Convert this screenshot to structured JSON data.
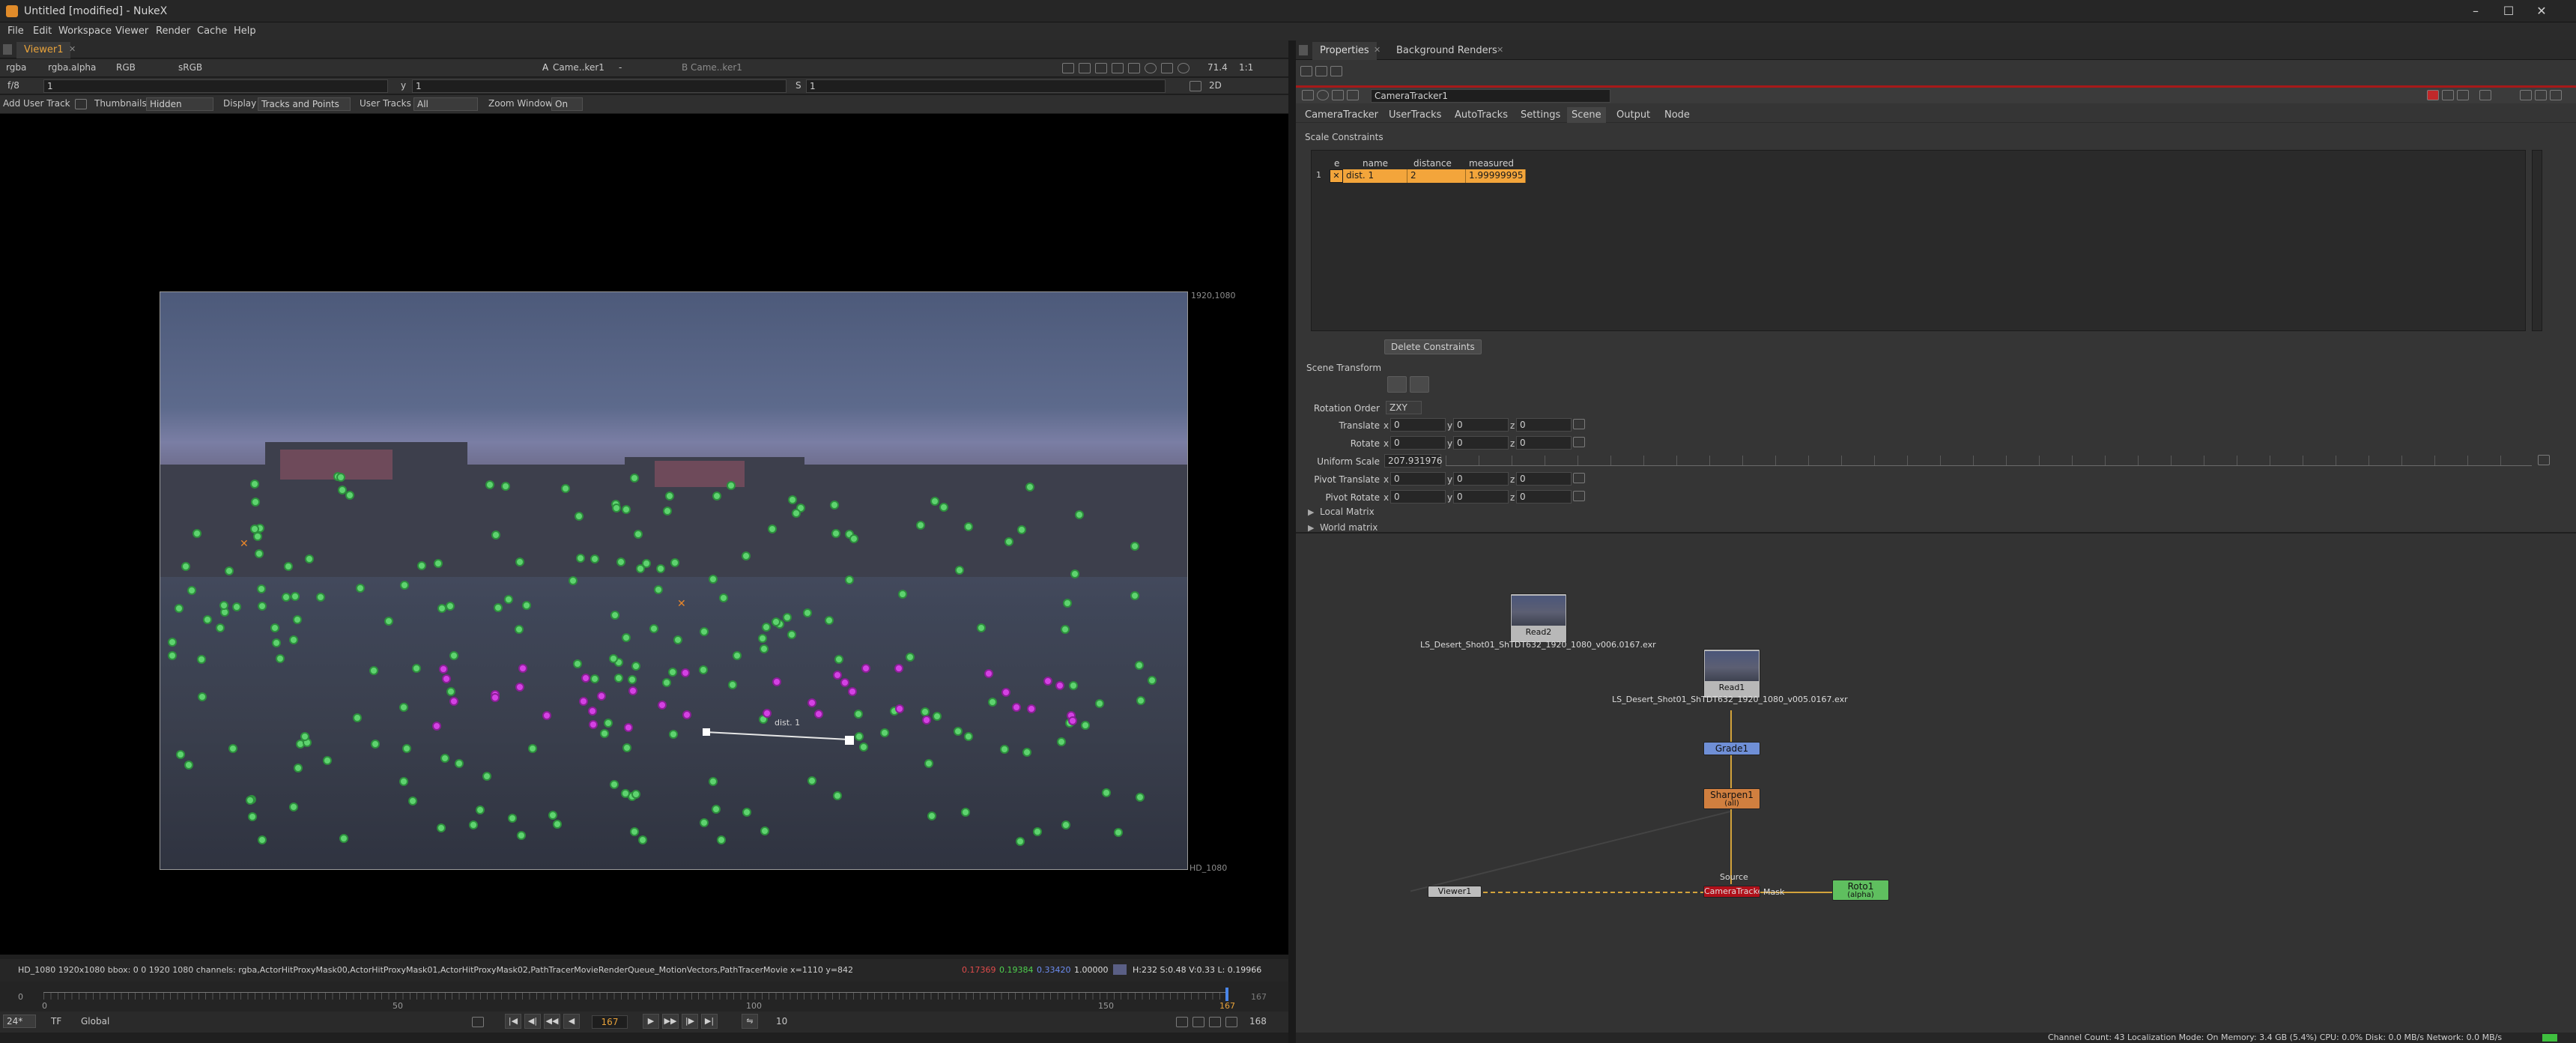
{
  "window": {
    "title": "Untitled [modified] - NukeX",
    "min_glyph": "–",
    "max_glyph": "☐",
    "close_glyph": "✕"
  },
  "menu": [
    "File",
    "Edit",
    "Workspace",
    "Viewer",
    "Render",
    "Cache",
    "Help"
  ],
  "viewer": {
    "tab_label": "Viewer1",
    "tab_close": "✕",
    "toolbar1": {
      "channels": "rgba",
      "alpha": "rgba.alpha",
      "colorspace": "RGB",
      "lut": "sRGB",
      "input_a_label": "A",
      "input_a": "Came..ker1",
      "input_a_op": "-",
      "input_b_label": "B",
      "input_b": "Came..ker1",
      "zoom": "71.4",
      "ratio": "1:1",
      "mode_2d": "2D"
    },
    "toolbar2": {
      "fstop_label": "f/8",
      "frame_val": "1",
      "gain_label": "y",
      "gamma_val": "1",
      "s_label": "S",
      "s_val": "1"
    },
    "toolbar3": {
      "add_user_track": "Add User Track",
      "thumbnails_label": "Thumbnails",
      "thumbnails_value": "Hidden",
      "display_label": "Display",
      "display_value": "Tracks and Points",
      "user_tracks_label": "User Tracks",
      "user_tracks_value": "All",
      "zoom_window_label": "Zoom Window",
      "zoom_window_value": "On"
    },
    "format_top_right": "1920,1080",
    "format_bottom_right": "HD_1080",
    "distance_label": "dist. 1",
    "status_text": "HD_1080 1920x1080  bbox: 0 0 1920 1080 channels: rgba,ActorHitProxyMask00,ActorHitProxyMask01,ActorHitProxyMask02,PathTracerMovieRenderQueue_MotionVectors,PathTracerMovie  x=1110 y=842",
    "pixel_r": "0.17369",
    "pixel_g": "0.19384",
    "pixel_b": "0.33420",
    "pixel_a": "1.00000",
    "pixel_hsv": "H:232 S:0.48 V:0.33  L: 0.19966",
    "timeline": {
      "start": "0",
      "ticks": [
        "0",
        "50",
        "100",
        "150"
      ],
      "end_label": "167",
      "end_right": "167"
    },
    "playbar": {
      "fps": "24*",
      "tf": "TF",
      "scope": "Global",
      "current_frame": "167",
      "step": "10",
      "out_frame": "168"
    }
  },
  "right_panel": {
    "tabs": [
      "Properties",
      "Background Renders"
    ],
    "tab_close": "✕",
    "node_name": "CameraTracker1",
    "node_tabs": [
      "CameraTracker",
      "UserTracks",
      "AutoTracks",
      "Settings",
      "Scene",
      "Output",
      "Node"
    ],
    "active_node_tab": "Scene",
    "scale_constraints_label": "Scale Constraints",
    "table": {
      "headers": [
        "e",
        "name",
        "distance",
        "measured"
      ],
      "rows": [
        {
          "index": "1",
          "enabled": "✕",
          "name": "dist. 1",
          "distance": "2",
          "measured": "1.99999995"
        }
      ]
    },
    "delete_constraints": "Delete Constraints",
    "scene_transform_label": "Scene Transform",
    "rotation_order_label": "Rotation Order",
    "rotation_order_value": "ZXY",
    "translate_label": "Translate",
    "rotate_label": "Rotate",
    "uniform_scale_label": "Uniform Scale",
    "uniform_scale_value": "207.931976",
    "pivot_translate_label": "Pivot Translate",
    "pivot_rotate_label": "Pivot Rotate",
    "axis_x": "x",
    "axis_y": "y",
    "axis_z": "z",
    "zero": "0",
    "local_matrix": "Local Matrix",
    "world_matrix": "World matrix"
  },
  "nodegraph": {
    "read2_label": "Read2",
    "read2_file": "LS_Desert_Shot01_ShTDT632_1920_1080_v006.0167.exr",
    "read1_label": "Read1",
    "read1_file": "LS_Desert_Shot01_ShTDT632_1920_1080_v005.0167.exr",
    "grade": "Grade1",
    "sharpen": "Sharpen1",
    "sharpen_sub": "(all)",
    "source_label": "Source",
    "cameratracker": "CameraTracker1",
    "mask_label": "Mask",
    "viewer": "Viewer1",
    "roto": "Roto1",
    "roto_sub": "(alpha)"
  },
  "statusbar": "Channel Count: 43  Localization Mode: On  Memory: 3.4 GB (5.4%)  CPU: 0.0%  Disk: 0.0 MB/s  Network: 0.0 MB/s",
  "colors": {
    "accent_orange": "#e8a23a",
    "track_green": "#5ed36f",
    "track_magenta": "#d441e4",
    "node_grade": "#6f8fd6",
    "node_sharpen": "#d07f3f",
    "node_roto": "#5fbf5f",
    "node_cameratracker": "#b0101a"
  }
}
